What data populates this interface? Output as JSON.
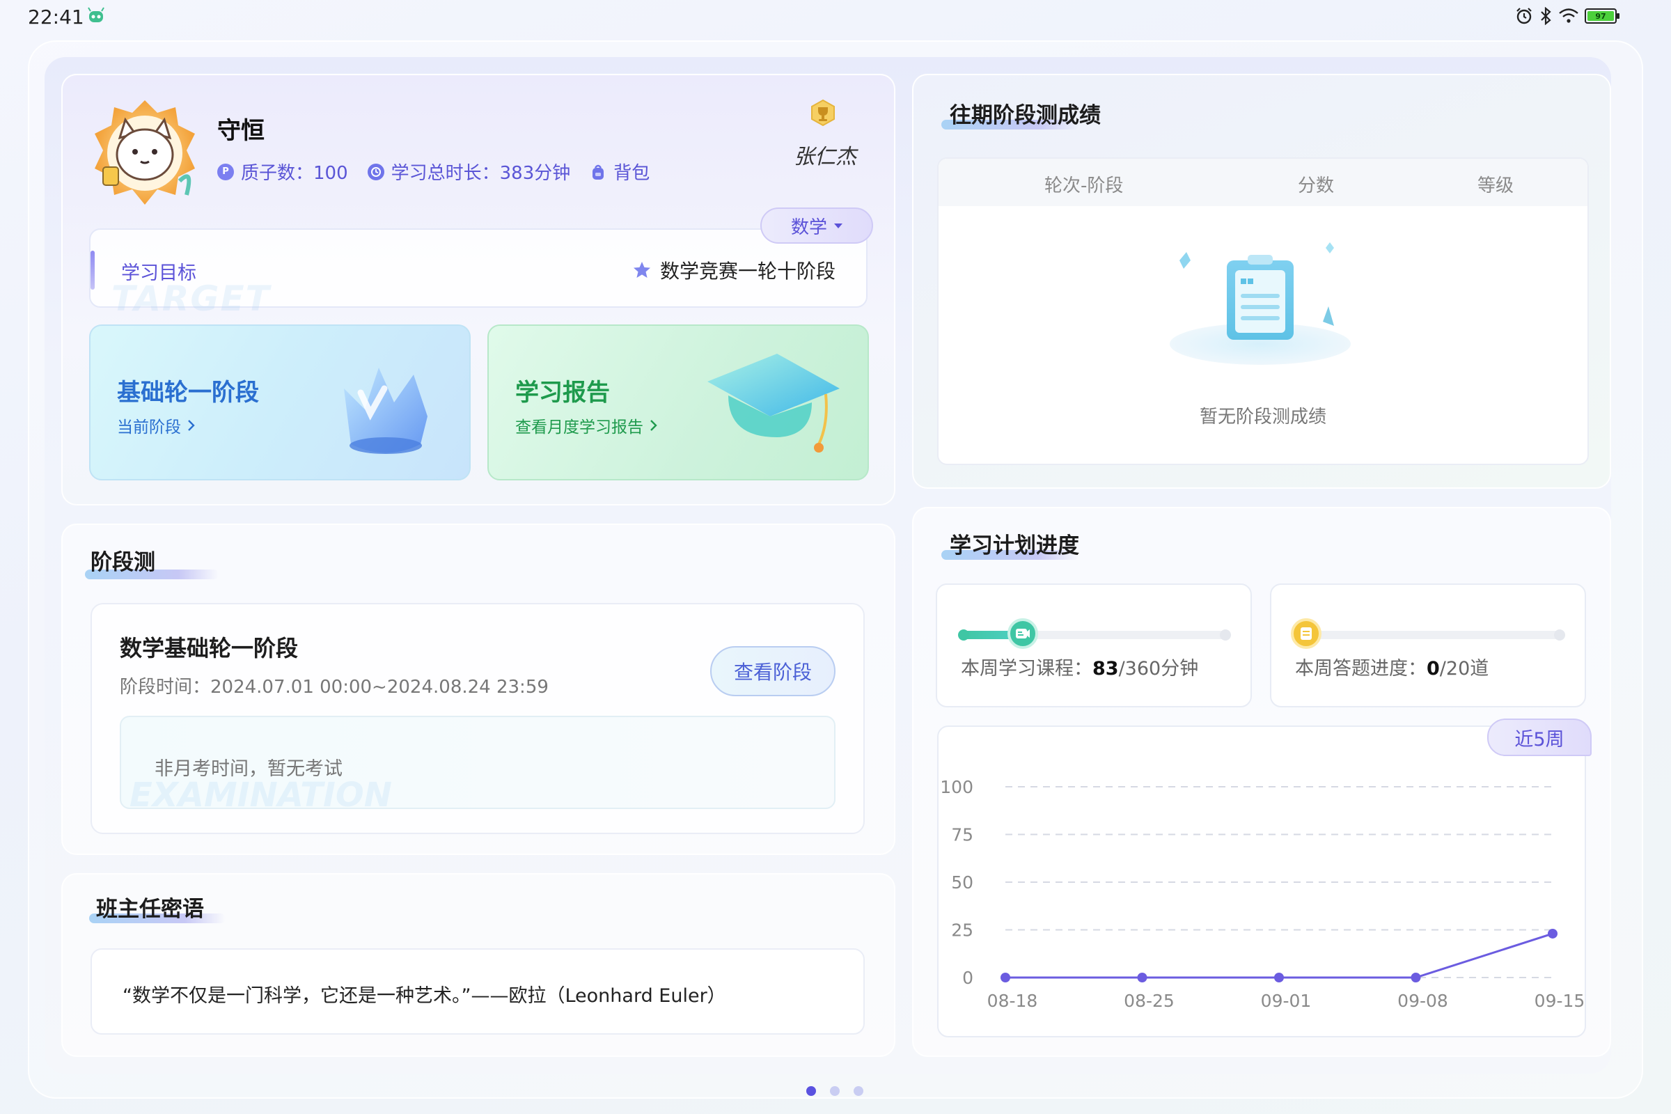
{
  "status_bar": {
    "time": "22:41",
    "battery": "97"
  },
  "profile": {
    "name": "守恒",
    "stats": [
      {
        "icon": "quark-icon",
        "label": "质子数：100"
      },
      {
        "icon": "clock-icon",
        "label": "学习总时长：383分钟"
      },
      {
        "icon": "backpack-icon",
        "label": "背包"
      }
    ],
    "signature": "张仁杰",
    "subject": "数学",
    "goal_label": "学习目标",
    "goal_watermark": "TARGET",
    "goal_value": "数学竞赛一轮十阶段"
  },
  "tiles": {
    "stage": {
      "title": "基础轮一阶段",
      "subtitle": "当前阶段"
    },
    "report": {
      "title": "学习报告",
      "subtitle": "查看月度学习报告"
    }
  },
  "stage_test": {
    "title": "阶段测",
    "exam_title": "数学基础轮一阶段",
    "exam_time": "阶段时间：2024.07.01 00:00~2024.08.24 23:59",
    "view_button": "查看阶段",
    "no_exam": "非月考时间，暂无考试",
    "no_exam_watermark": "EXAMINATION"
  },
  "teacher": {
    "title": "班主任密语",
    "quote": "“数学不仅是一门科学，它还是一种艺术。”——欧拉（Leonhard Euler）"
  },
  "past_scores": {
    "title": "往期阶段测成绩",
    "columns": [
      "轮次-阶段",
      "分数",
      "等级"
    ],
    "empty_text": "暂无阶段测成绩"
  },
  "plan": {
    "title": "学习计划进度",
    "course": {
      "label": "本周学习课程：",
      "value": "83",
      "total": "/360分钟",
      "progress": 0.23
    },
    "answers": {
      "label": "本周答题进度：",
      "value": "0",
      "total": "/20道",
      "progress": 0
    },
    "range_tab": "近5周"
  },
  "chart_data": {
    "type": "line",
    "categories": [
      "08-18",
      "08-25",
      "09-01",
      "09-08",
      "09-15"
    ],
    "y_ticks": [
      "100",
      "75",
      "50",
      "25",
      "0"
    ],
    "values": [
      0,
      0,
      0,
      0,
      23
    ],
    "ylim": [
      0,
      100
    ],
    "grid": true,
    "colors": {
      "line": "#6b5ce0",
      "grid": "#d6d9e3"
    }
  },
  "pager": {
    "count": 3,
    "active": 0
  },
  "colors": {
    "accent": "#5b52d8",
    "tile_stage_text": "#2a6fd0",
    "tile_report_text": "#1e9a4c"
  }
}
